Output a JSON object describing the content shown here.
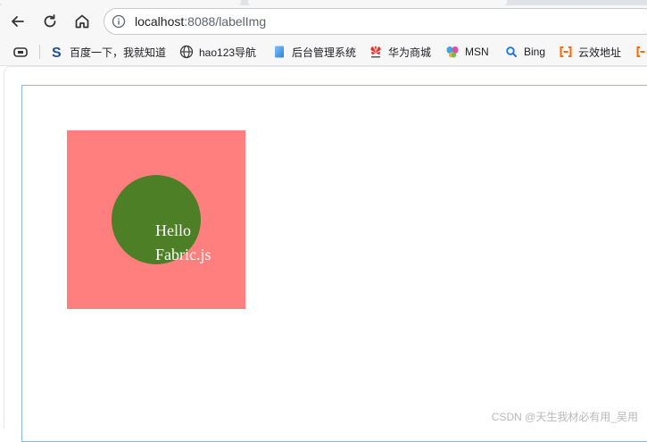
{
  "browser": {
    "address": {
      "host": "localhost",
      "path": ":8088/labelImg"
    },
    "bookmarks": [
      {
        "label": "百度一下，我就知道",
        "icon": "baidu-icon"
      },
      {
        "label": "hao123导航",
        "icon": "globe-icon"
      },
      {
        "label": "后台管理系统",
        "icon": "page-icon"
      },
      {
        "label": "华为商城",
        "icon": "huawei-icon"
      },
      {
        "label": "MSN",
        "icon": "msn-icon"
      },
      {
        "label": "Bing",
        "icon": "search-icon"
      },
      {
        "label": "云效地址",
        "icon": "aliyun-icon"
      }
    ]
  },
  "canvas": {
    "rect_color": "#ff7f7f",
    "circle_color": "#4c7f26",
    "text_line1": "Hello",
    "text_line2": "Fabric.js",
    "text_color": "#ffffff"
  },
  "watermark": "CSDN @天生我材必有用_吴用"
}
